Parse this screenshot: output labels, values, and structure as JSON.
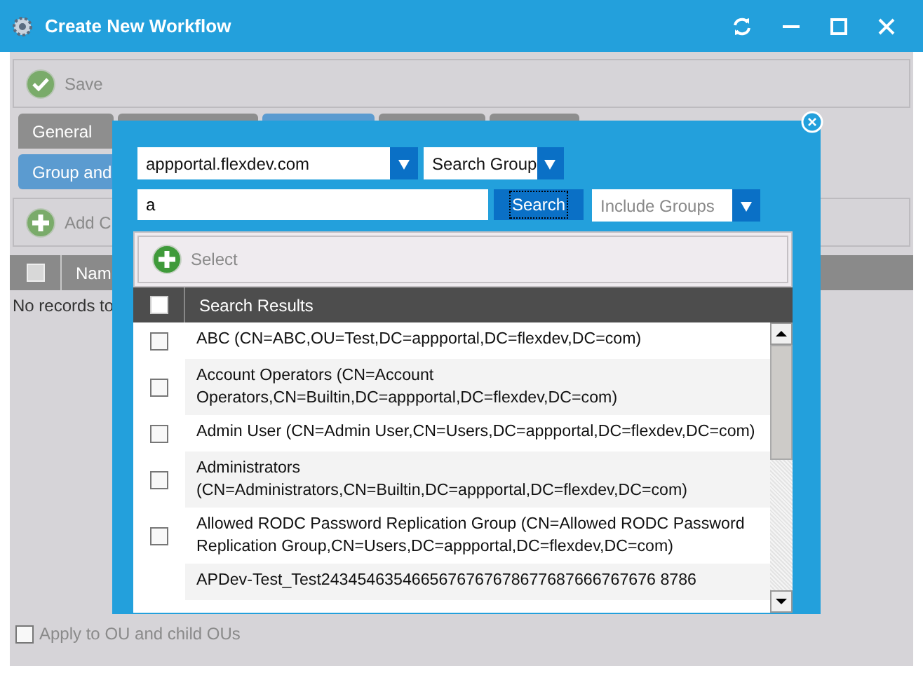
{
  "window": {
    "title": "Create New Workflow"
  },
  "toolbar": {
    "save": "Save"
  },
  "tabs_row1": [
    {
      "label": "General",
      "selected": false
    },
    {
      "selected": false
    },
    {
      "selected": true
    },
    {
      "selected": false
    },
    {
      "selected": false
    }
  ],
  "tabs_row2": [
    {
      "label": "Group and",
      "selected": true
    }
  ],
  "add_button": "Add C",
  "table": {
    "header": "Nam",
    "header_checked": false,
    "empty": "No records to"
  },
  "apply_checkbox": {
    "label": "Apply to OU and child OUs",
    "checked": false
  },
  "dialog": {
    "domain": "appportal.flexdev.com",
    "search_type": "Search Group",
    "query": "a",
    "search_button": "Search",
    "include": "Include Groups",
    "select_button": "Select",
    "header": "Search Results",
    "header_checked": false,
    "rows": [
      {
        "text": "ABC (CN=ABC,OU=Test,DC=appportal,DC=flexdev,DC=com)",
        "checked": false
      },
      {
        "text": "Account Operators (CN=Account Operators,CN=Builtin,DC=appportal,DC=flexdev,DC=com)",
        "checked": false
      },
      {
        "text": "Admin User (CN=Admin User,CN=Users,DC=appportal,DC=flexdev,DC=com)",
        "checked": false
      },
      {
        "text": "Administrators (CN=Administrators,CN=Builtin,DC=appportal,DC=flexdev,DC=com)",
        "checked": false
      },
      {
        "text": "Allowed RODC Password Replication Group (CN=Allowed RODC Password Replication Group,CN=Users,DC=appportal,DC=flexdev,DC=com)",
        "checked": false
      },
      {
        "text": "APDev-Test_Test2434546354665676767678677687666767676 8786"
      }
    ]
  }
}
